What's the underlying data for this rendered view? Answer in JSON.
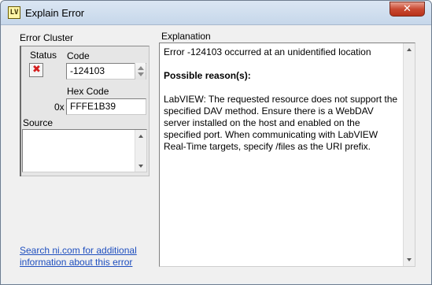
{
  "window": {
    "title": "Explain Error",
    "icon_text": "LV",
    "close_label": "✕"
  },
  "error_cluster": {
    "label": "Error Cluster",
    "status_label": "Status",
    "status_value": "✖",
    "code_label": "Code",
    "code_value": "-124103",
    "hex_label": "Hex Code",
    "hex_prefix": "0x",
    "hex_value": "FFFE1B39",
    "source_label": "Source",
    "source_value": ""
  },
  "explanation": {
    "label": "Explanation",
    "line1": "Error -124103 occurred at an unidentified location",
    "heading": "Possible reason(s):",
    "body": "LabVIEW:  The requested resource does not support the specified DAV method. Ensure there is a WebDAV server installed on the host and enabled on the specified port. When communicating with LabVIEW Real-Time targets, specify /files as the URI prefix."
  },
  "link": {
    "text": "Search ni.com for additional information about this error"
  },
  "colors": {
    "status_error": "#d41f1f",
    "link": "#1f4fbf"
  }
}
